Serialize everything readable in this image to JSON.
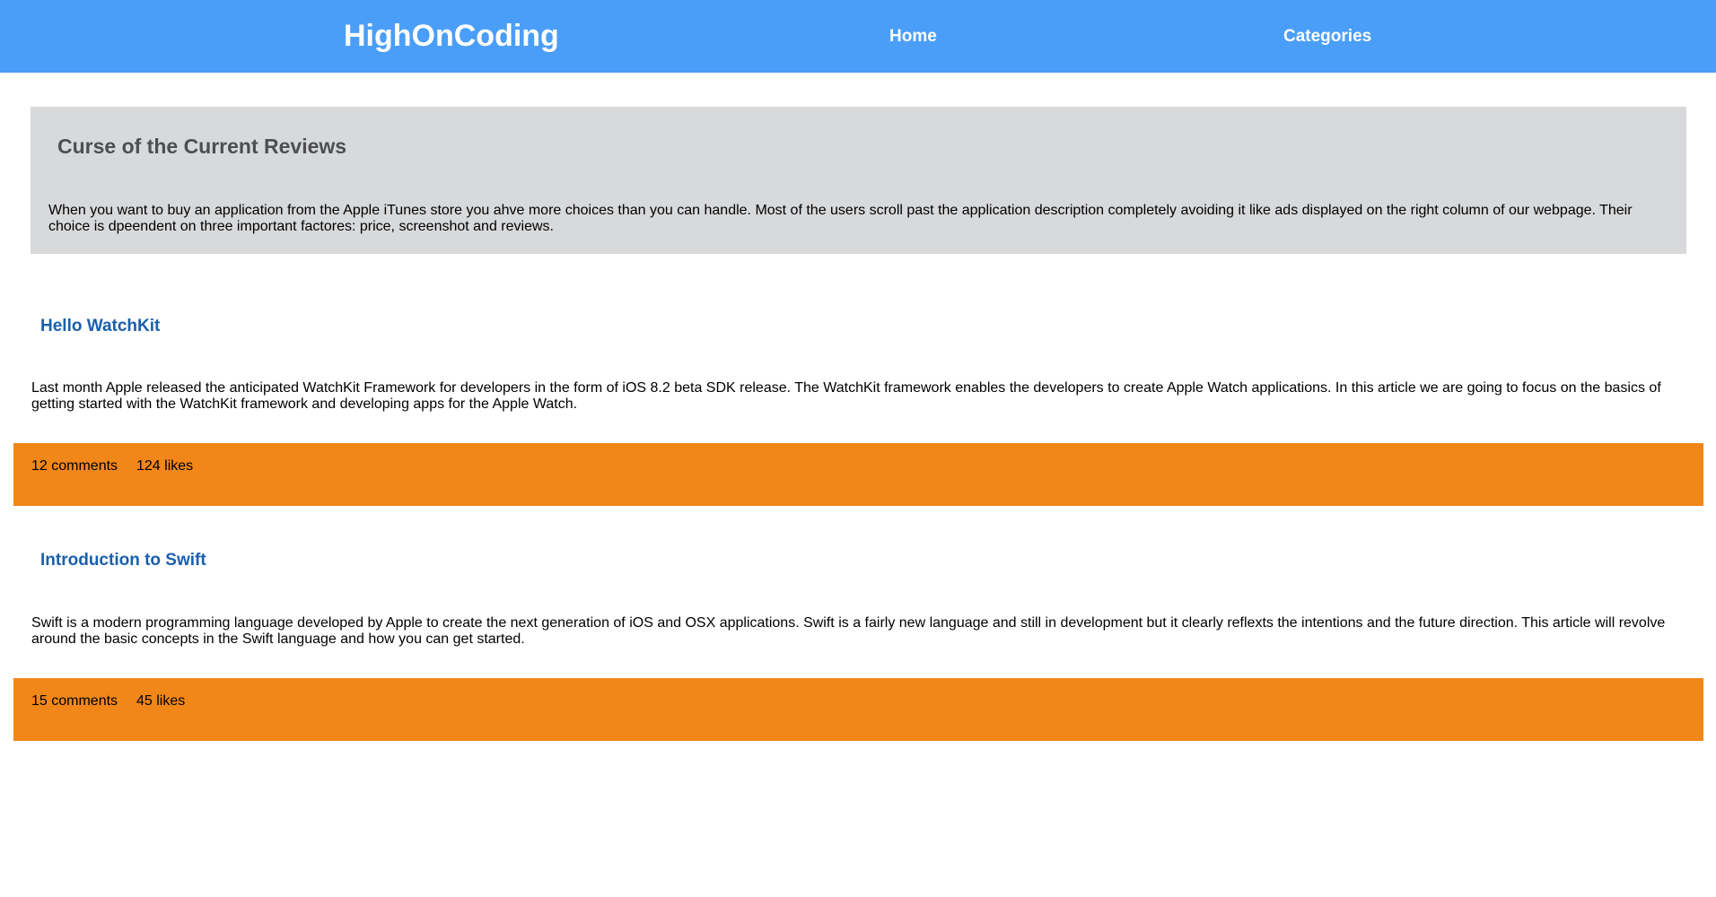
{
  "header": {
    "brand": "HighOnCoding",
    "nav": [
      {
        "label": "Home"
      },
      {
        "label": "Categories"
      }
    ]
  },
  "hero": {
    "title": "Curse of the Current Reviews",
    "text": "When you want to buy an application from the Apple iTunes store you ahve more choices than you can handle. Most of the users scroll past the application description completely avoiding it like ads displayed on the right column of our webpage. Their choice is dpeendent on three important factores: price, screenshot and reviews."
  },
  "posts": [
    {
      "title": "Hello WatchKit",
      "text": "Last month Apple released the anticipated WatchKit Framework for developers in the form of iOS 8.2 beta SDK release. The WatchKit framework enables the developers to create Apple Watch applications. In this article we are going to focus on the basics of getting started with the WatchKit framework and developing apps for the Apple Watch.",
      "comments": "12 comments",
      "likes": "124 likes"
    },
    {
      "title": "Introduction to Swift",
      "text": "Swift is a modern programming language developed by Apple to create the next generation of iOS and OSX applications. Swift is a fairly new language and still in development but it clearly reflexts the intentions and the future direction. This article will revolve around the basic concepts in the Swift language and how you can get started.",
      "comments": "15 comments",
      "likes": "45 likes"
    }
  ],
  "colors": {
    "navbar": "#4a9ef8",
    "hero_background": "#d8d9db",
    "post_title": "#1a5fad",
    "footer_background": "#f18619"
  }
}
